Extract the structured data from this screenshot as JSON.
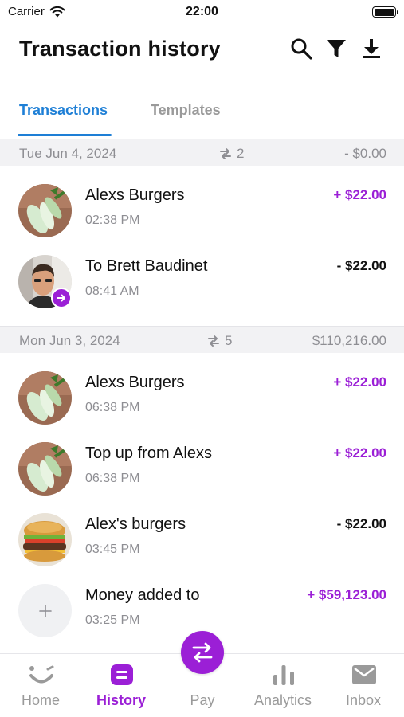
{
  "status_bar": {
    "carrier": "Carrier",
    "time": "22:00"
  },
  "header": {
    "title": "Transaction history"
  },
  "tabs": [
    {
      "label": "Transactions",
      "active": true
    },
    {
      "label": "Templates",
      "active": false
    }
  ],
  "groups": [
    {
      "date": "Tue Jun 4, 2024",
      "count": "2",
      "total": "- $0.00",
      "transactions": [
        {
          "name": "Alexs Burgers",
          "time": "02:38 PM",
          "amount": "+ $22.00",
          "avatar": "bok-choy-photo"
        },
        {
          "name": "To Brett Baudinet",
          "time": "08:41 AM",
          "amount": "- $22.00",
          "avatar": "person-photo"
        }
      ]
    },
    {
      "date": "Mon Jun 3, 2024",
      "count": "5",
      "total": "$110,216.00",
      "transactions": [
        {
          "name": "Alexs Burgers",
          "time": "06:38 PM",
          "amount": "+ $22.00",
          "avatar": "bok-choy-photo"
        },
        {
          "name": "Top up from Alexs",
          "time": "06:38 PM",
          "amount": "+ $22.00",
          "avatar": "bok-choy-photo"
        },
        {
          "name": "Alex's burgers",
          "time": "03:45 PM",
          "amount": "- $22.00",
          "avatar": "burger-photo"
        },
        {
          "name": "Money added to",
          "time": "03:25 PM",
          "amount": "+ $59,123.00",
          "avatar": "plus-icon"
        }
      ]
    }
  ],
  "bottom_nav": [
    {
      "label": "Home",
      "icon": "smile-icon",
      "active": false
    },
    {
      "label": "History",
      "icon": "history-icon",
      "active": true
    },
    {
      "label": "Pay",
      "icon": "transfer-icon",
      "active": false
    },
    {
      "label": "Analytics",
      "icon": "bar-chart-icon",
      "active": false
    },
    {
      "label": "Inbox",
      "icon": "mail-icon",
      "active": false
    }
  ],
  "colors": {
    "accent": "#9b1fd6",
    "tab_active": "#1e7fd6",
    "muted": "#8e8e93"
  }
}
